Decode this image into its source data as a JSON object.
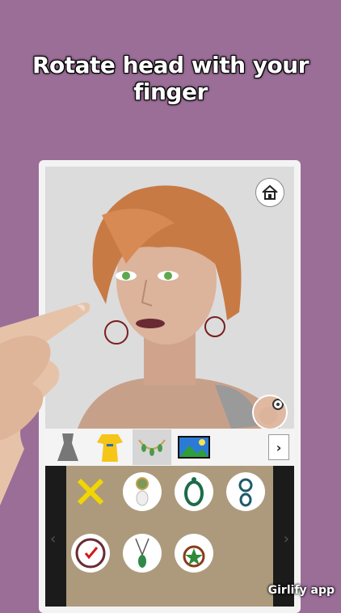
{
  "headline": "Rotate head with your finger",
  "brand": "Girlify app",
  "toolbar": {
    "items": [
      "dress-front-icon",
      "dress-back-icon",
      "necklace-icon",
      "landscape-icon"
    ],
    "selected": 2,
    "next_label": "›"
  },
  "accessories": [
    "remove-icon",
    "pearl-pendant-icon",
    "ring-pendant-icon",
    "double-ring-pendant-icon",
    "watch-icon",
    "green-pendant-icon",
    "star-pendant-icon"
  ],
  "colors": {
    "background": "#9b6e98",
    "panel": "#ad9a7c",
    "remove": "#f2d600",
    "hair": "#c87a45"
  }
}
